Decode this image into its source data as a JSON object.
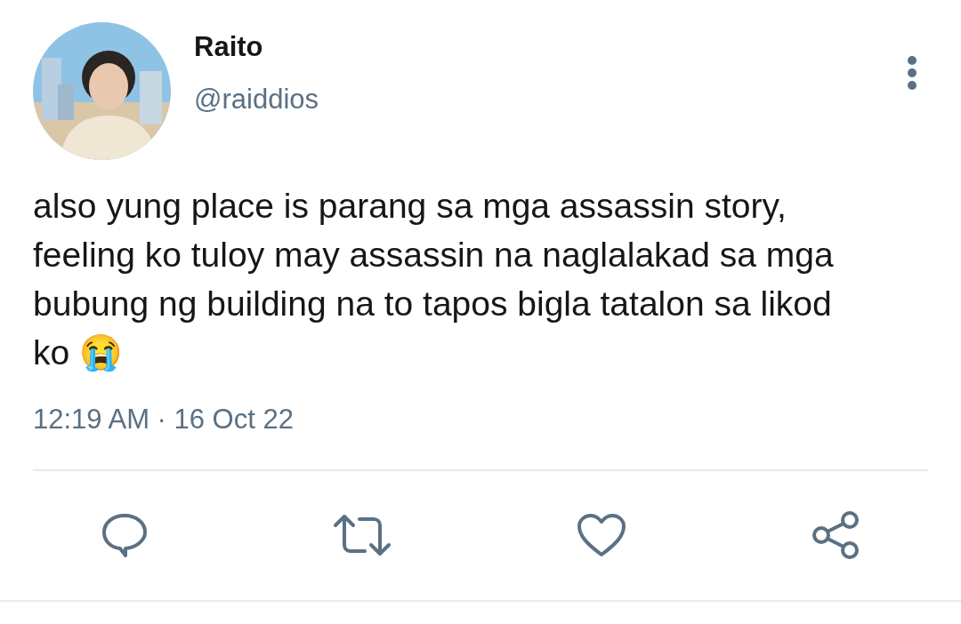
{
  "author": {
    "name": "Raito",
    "handle": "@raiddios"
  },
  "tweet": {
    "text": "also yung place is parang sa mga assassin story, feeling ko tuloy may assassin na naglalakad sa mga bubung ng building na to tapos bigla tatalon sa likod ko 😭",
    "timestamp": "12:19 AM · 16 Oct 22"
  },
  "actions": [
    {
      "kind": "reply"
    },
    {
      "kind": "retweet"
    },
    {
      "kind": "like"
    },
    {
      "kind": "share"
    }
  ]
}
